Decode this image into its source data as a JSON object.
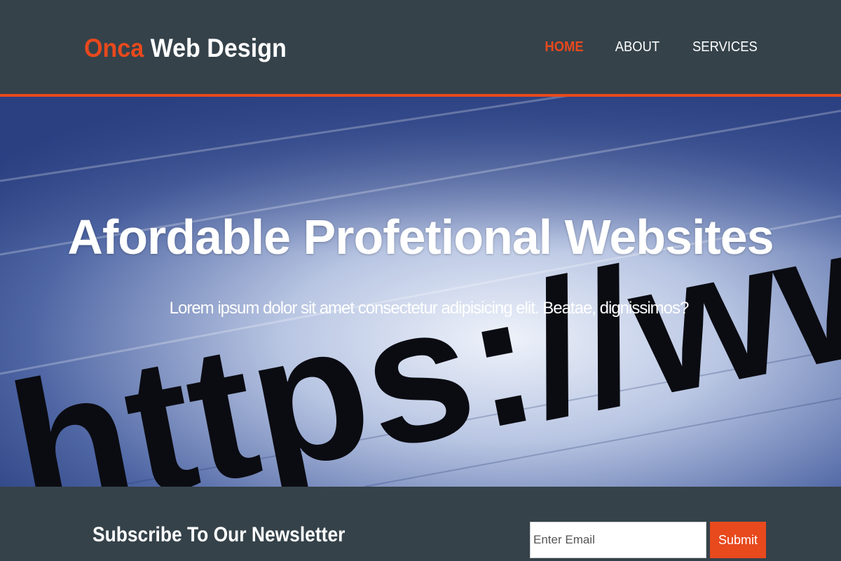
{
  "header": {
    "logo_highlight": "Onca",
    "logo_rest": "Web Design",
    "nav": [
      {
        "label": "HOME",
        "current": true
      },
      {
        "label": "ABOUT",
        "current": false
      },
      {
        "label": "SERVICES",
        "current": false
      }
    ]
  },
  "showcase": {
    "title": "Afordable Profetional Websites",
    "subtitle": "Lorem ipsum dolor sit amet consectetur adipisicing elit. Beatae, dignissimos?",
    "background_text": "https://www"
  },
  "newsletter": {
    "heading": "Subscribe To Our Newsletter",
    "email_placeholder": "Enter Email",
    "submit_label": "Submit"
  },
  "colors": {
    "brand_accent": "#e8491d",
    "header_bg": "#35424a"
  }
}
